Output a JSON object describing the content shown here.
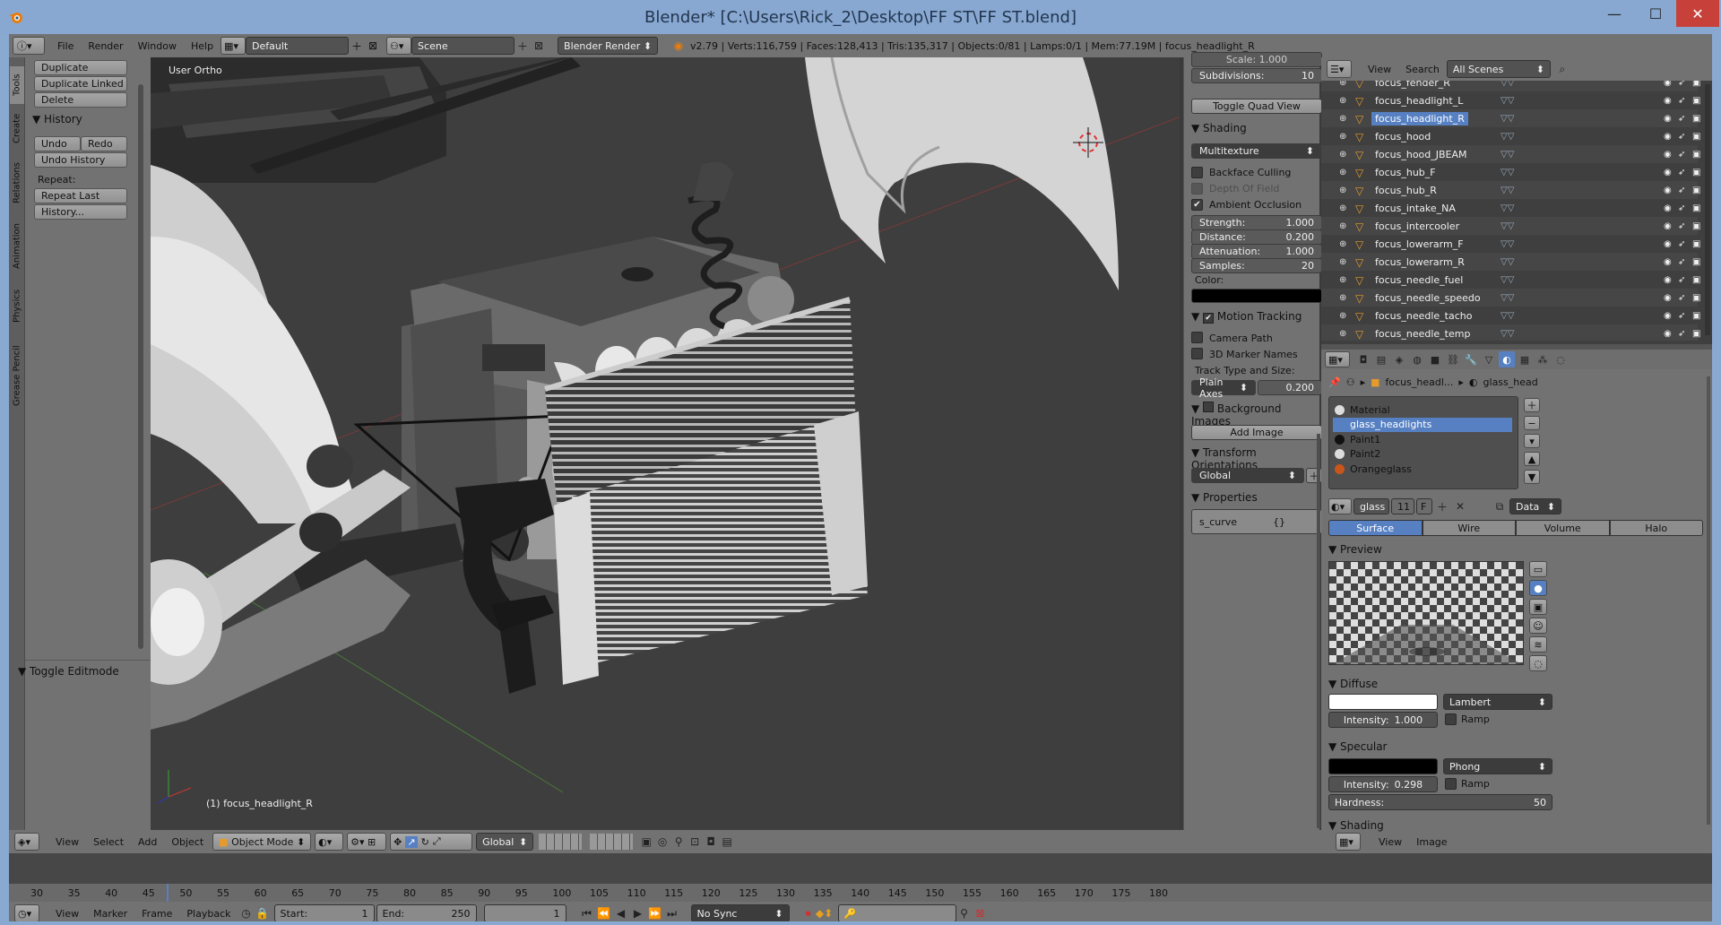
{
  "window": {
    "title": "Blender* [C:\\Users\\Rick_2\\Desktop\\FF ST\\FF ST.blend]",
    "min": "—",
    "max": "☐",
    "close": "✕"
  },
  "infobar": {
    "menus": [
      "File",
      "Render",
      "Window",
      "Help"
    ],
    "layout": "Default",
    "scene": "Scene",
    "engine": "Blender Render",
    "stats": "v2.79 | Verts:116,759 | Faces:128,413 | Tris:135,317 | Objects:0/81 | Lamps:0/1 | Mem:77.19M | focus_headlight_R"
  },
  "toolshelf": {
    "tabs": [
      "Tools",
      "Create",
      "Relations",
      "Animation",
      "Physics",
      "Grease Pencil"
    ],
    "edit_buttons": [
      "Duplicate",
      "Duplicate Linked",
      "Delete"
    ],
    "history_title": "History",
    "undo": "Undo",
    "redo": "Redo",
    "undo_history": "Undo History",
    "repeat_label": "Repeat:",
    "repeat_last": "Repeat Last",
    "history_menu": "History...",
    "toggle_editmode": "Toggle Editmode"
  },
  "viewport": {
    "view_label": "User Ortho",
    "object_label": "(1) focus_headlight_R"
  },
  "npanel": {
    "scale_label": "Scale:",
    "scale_value": "1.000",
    "subdiv_label": "Subdivisions:",
    "subdiv_value": "10",
    "toggle_quad": "Toggle Quad View",
    "shading_title": "Shading",
    "shading_mode": "Multitexture",
    "backface": "Backface Culling",
    "dof": "Depth Of Field",
    "ao": "Ambient Occlusion",
    "strength_label": "Strength:",
    "strength_value": "1.000",
    "distance_label": "Distance:",
    "distance_value": "0.200",
    "attenuation_label": "Attenuation:",
    "attenuation_value": "1.000",
    "samples_label": "Samples:",
    "samples_value": "20",
    "color_label": "Color:",
    "motion_title": "Motion Tracking",
    "camera_path": "Camera Path",
    "marker_names": "3D Marker Names",
    "track_label": "Track Type and Size:",
    "track_type": "Plain Axes",
    "track_size": "0.200",
    "bg_title": "Background Images",
    "add_image": "Add Image",
    "transform_title": "Transform Orientations",
    "transform_value": "Global",
    "props_title": "Properties",
    "prop_name": "s_curve",
    "prop_value": "{}"
  },
  "outliner": {
    "view": "View",
    "search": "Search",
    "filter": "All Scenes",
    "items": [
      {
        "name": "focus_fender_R",
        "sel": false
      },
      {
        "name": "focus_headlight_L",
        "sel": false
      },
      {
        "name": "focus_headlight_R",
        "sel": true
      },
      {
        "name": "focus_hood",
        "sel": false
      },
      {
        "name": "focus_hood_JBEAM",
        "sel": false
      },
      {
        "name": "focus_hub_F",
        "sel": false
      },
      {
        "name": "focus_hub_R",
        "sel": false
      },
      {
        "name": "focus_intake_NA",
        "sel": false
      },
      {
        "name": "focus_intercooler",
        "sel": false
      },
      {
        "name": "focus_lowerarm_F",
        "sel": false
      },
      {
        "name": "focus_lowerarm_R",
        "sel": false
      },
      {
        "name": "focus_needle_fuel",
        "sel": false
      },
      {
        "name": "focus_needle_speedo",
        "sel": false
      },
      {
        "name": "focus_needle_tacho",
        "sel": false
      },
      {
        "name": "focus_needle_temp",
        "sel": false
      }
    ]
  },
  "properties": {
    "crumb_obj": "focus_headl...",
    "crumb_mat": "glass_head",
    "slots": [
      "Material",
      "glass_headlights",
      "Paint1",
      "Paint2",
      "Orangeglass"
    ],
    "mat_name": "glass",
    "mat_users": "11",
    "mat_f": "F",
    "data": "Data",
    "tabs": [
      "Surface",
      "Wire",
      "Volume",
      "Halo"
    ],
    "preview_title": "Preview",
    "diffuse_title": "Diffuse",
    "diffuse_shader": "Lambert",
    "intensity_label": "Intensity:",
    "diffuse_intensity": "1.000",
    "ramp": "Ramp",
    "specular_title": "Specular",
    "specular_shader": "Phong",
    "spec_intensity": "0.298",
    "hardness_label": "Hardness:",
    "hardness": "50",
    "shading_title": "Shading"
  },
  "v3dheader": {
    "menus": [
      "View",
      "Select",
      "Add",
      "Object"
    ],
    "mode": "Object Mode",
    "orientation": "Global",
    "right_view": "View",
    "right_image": "Image"
  },
  "timeline": {
    "ticks": [
      "30",
      "35",
      "40",
      "45",
      "50",
      "55",
      "60",
      "65",
      "70",
      "75",
      "80",
      "85",
      "90",
      "95",
      "100",
      "105",
      "110",
      "115",
      "120",
      "125",
      "130",
      "135",
      "140",
      "145",
      "150",
      "155",
      "160",
      "165",
      "170",
      "175",
      "180"
    ],
    "menus": [
      "View",
      "Marker",
      "Frame",
      "Playback"
    ],
    "start_label": "Start:",
    "start": "1",
    "end_label": "End:",
    "end": "250",
    "current": "1",
    "sync": "No Sync"
  }
}
